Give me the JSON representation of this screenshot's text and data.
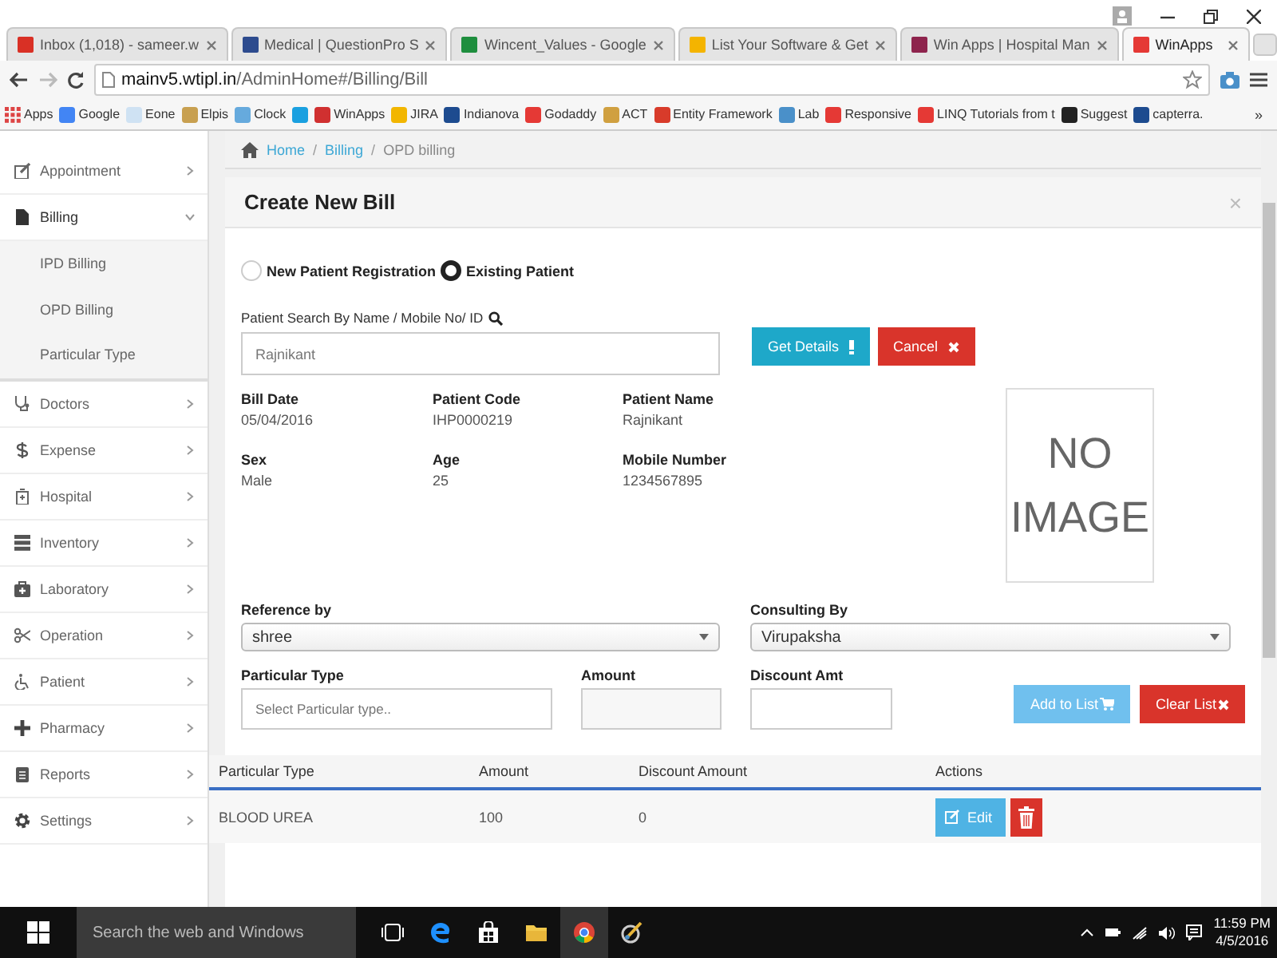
{
  "browser": {
    "tabs": [
      {
        "title": "Inbox (1,018) - sameer.w",
        "selected": false
      },
      {
        "title": "Medical | QuestionPro S",
        "selected": false
      },
      {
        "title": "Wincent_Values - Google",
        "selected": false
      },
      {
        "title": "List Your Software & Get",
        "selected": false
      },
      {
        "title": "Win Apps | Hospital Man",
        "selected": false
      },
      {
        "title": "WinApps",
        "selected": true
      }
    ],
    "url": {
      "host": "mainv5.wtipl.in",
      "path": "/AdminHome#/Billing/Bill"
    },
    "bookmarks": [
      {
        "kind": "link",
        "label": "Apps"
      },
      {
        "kind": "link",
        "label": "Google"
      },
      {
        "kind": "link",
        "label": "Eone"
      },
      {
        "kind": "link",
        "label": "Elpis"
      },
      {
        "kind": "link",
        "label": "Clock"
      },
      {
        "kind": "icon"
      },
      {
        "kind": "link",
        "label": "WinApps"
      },
      {
        "kind": "link",
        "label": "JIRA"
      },
      {
        "kind": "link",
        "label": "Indianova"
      },
      {
        "kind": "link",
        "label": "Godaddy"
      },
      {
        "kind": "link",
        "label": "ACT"
      },
      {
        "kind": "link",
        "label": "Entity Framework"
      },
      {
        "kind": "link",
        "label": "Lab"
      },
      {
        "kind": "link",
        "label": "Responsive"
      },
      {
        "kind": "link",
        "label": "LINQ Tutorials from t"
      },
      {
        "kind": "link",
        "label": "Suggest"
      },
      {
        "kind": "link",
        "label": "capterra."
      }
    ],
    "bookmarks_overflow": "»"
  },
  "sidebar": {
    "items": [
      {
        "label": "Appointment",
        "expanded": false
      },
      {
        "label": "Billing",
        "expanded": true,
        "children": [
          {
            "label": "IPD Billing"
          },
          {
            "label": "OPD Billing"
          },
          {
            "label": "Particular Type"
          }
        ]
      },
      {
        "label": "Doctors",
        "expanded": false
      },
      {
        "label": "Expense",
        "expanded": false
      },
      {
        "label": "Hospital",
        "expanded": false
      },
      {
        "label": "Inventory",
        "expanded": false
      },
      {
        "label": "Laboratory",
        "expanded": false
      },
      {
        "label": "Operation",
        "expanded": false
      },
      {
        "label": "Patient",
        "expanded": false
      },
      {
        "label": "Pharmacy",
        "expanded": false
      },
      {
        "label": "Reports",
        "expanded": false
      },
      {
        "label": "Settings",
        "expanded": false
      }
    ]
  },
  "breadcrumb_separator": "/",
  "breadcrumb": [
    {
      "label": "Home",
      "current": false
    },
    {
      "label": "Billing",
      "current": false
    },
    {
      "label": "OPD billing",
      "current": true
    }
  ],
  "card": {
    "title": "Create New Bill",
    "close": "×",
    "patient_mode": [
      {
        "label": "New Patient Registration",
        "selected": false
      },
      {
        "label": "Existing Patient",
        "selected": true
      }
    ],
    "search": {
      "label": "Patient Search By Name / Mobile No/ ID",
      "value": "Rajnikant"
    },
    "search_buttons": [
      {
        "label": "Get Details",
        "kind": "info"
      },
      {
        "label": "Cancel",
        "kind": "danger"
      }
    ],
    "details": [
      {
        "label": "Bill Date",
        "value": "05/04/2016"
      },
      {
        "label": "Patient Code",
        "value": "IHP0000219"
      },
      {
        "label": "Patient Name",
        "value": "Rajnikant"
      },
      {
        "label": "Sex",
        "value": "Male"
      },
      {
        "label": "Age",
        "value": "25"
      },
      {
        "label": "Mobile Number",
        "value": "1234567895"
      }
    ],
    "photo_placeholder": "NO IMAGE",
    "reference_by": {
      "label": "Reference by",
      "value": "shree"
    },
    "consulting_by": {
      "label": "Consulting By",
      "value": "Virupaksha"
    },
    "particular_type": {
      "label": "Particular Type",
      "placeholder": "Select Particular type.."
    },
    "amount": {
      "label": "Amount"
    },
    "discount": {
      "label": "Discount Amt"
    },
    "list_buttons": [
      {
        "label": "Add to List",
        "kind": "info",
        "disabled": true
      },
      {
        "label": "Clear List",
        "kind": "danger",
        "disabled": false
      }
    ],
    "table": {
      "columns": [
        "Particular Type",
        "Amount",
        "Discount Amount",
        "Actions"
      ],
      "rows": [
        {
          "cells": [
            "BLOOD UREA",
            "100",
            "0"
          ],
          "edit": "Edit"
        }
      ]
    }
  },
  "taskbar": {
    "search_placeholder": "Search the web and Windows",
    "time": "11:59 PM",
    "date": "4/5/2016"
  }
}
